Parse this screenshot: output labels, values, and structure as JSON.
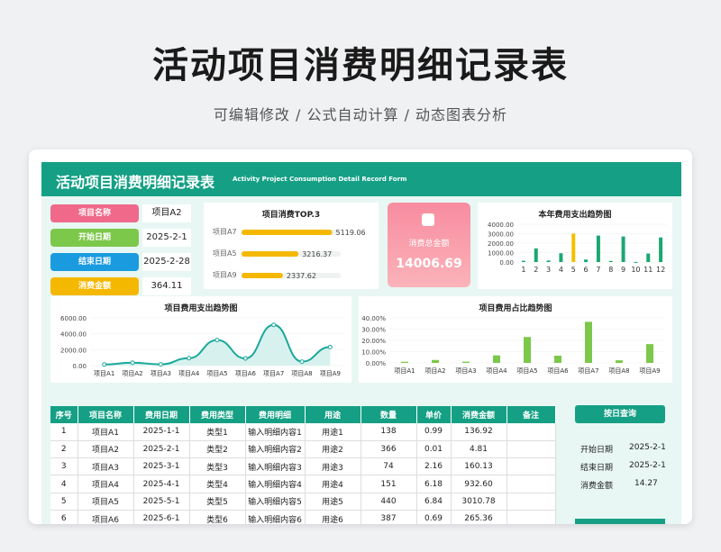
{
  "page": {
    "title": "活动项目消费明细记录表",
    "subtitle": "可编辑修改 /  公式自动计算  /  动态图表分析"
  },
  "banner": {
    "title": "活动项目消费明细记录表",
    "subtitle_en": "Activity Project Consumption Detail Record Form"
  },
  "info": [
    {
      "label": "项目名称",
      "value": "项目A2",
      "color": "#f0698a"
    },
    {
      "label": "开始日期",
      "value": "2025-2-1",
      "color": "#7cc84a"
    },
    {
      "label": "结束日期",
      "value": "2025-2-28",
      "color": "#1a9be0"
    },
    {
      "label": "消费金额",
      "value": "364.11",
      "color": "#f5b800"
    }
  ],
  "total": {
    "label": "消费总金额",
    "value": "14006.69"
  },
  "top3": {
    "title": "项目消费TOP.3",
    "items": [
      {
        "name": "项目A7",
        "value": "5119.06",
        "num": 5119.06
      },
      {
        "name": "项目A5",
        "value": "3216.37",
        "num": 3216.37
      },
      {
        "name": "项目A9",
        "value": "2337.62",
        "num": 2337.62
      }
    ],
    "bar_color": "#f5b800"
  },
  "chart_data": [
    {
      "type": "bar",
      "title": "本年费用支出趋势图",
      "categories": [
        "1",
        "2",
        "3",
        "4",
        "5",
        "6",
        "7",
        "8",
        "9",
        "10",
        "11",
        "12"
      ],
      "values": [
        136.92,
        1440,
        160.13,
        932.6,
        3010.78,
        265.36,
        2800,
        120,
        2700,
        14.27,
        900,
        2600
      ],
      "highlight_index": 4,
      "yticks": [
        "4000.00",
        "3000.00",
        "2000.00",
        "1000.00",
        "0.00"
      ],
      "ylim": [
        0,
        4000
      ],
      "colors": {
        "bar": "#1ba772",
        "highlight": "#f5c000"
      }
    },
    {
      "type": "area",
      "title": "项目费用支出趋势图",
      "categories": [
        "项目A1",
        "项目A2",
        "项目A3",
        "项目A4",
        "项目A5",
        "项目A6",
        "项目A7",
        "项目A8",
        "项目A9"
      ],
      "values": [
        136.92,
        364.11,
        160.13,
        932.6,
        3216.37,
        900,
        5119.06,
        500,
        2337.62
      ],
      "yticks": [
        "6000.00",
        "4000.00",
        "2000.00",
        "0.00"
      ],
      "ylim": [
        0,
        6000
      ],
      "colors": {
        "line": "#1aa89a",
        "fill": "#d7f2ee"
      }
    },
    {
      "type": "bar",
      "title": "项目费用占比趋势图",
      "categories": [
        "项目A1",
        "项目A2",
        "项目A3",
        "项目A4",
        "项目A5",
        "项目A6",
        "项目A7",
        "项目A8",
        "项目A9"
      ],
      "values": [
        1.0,
        2.6,
        1.1,
        6.7,
        23.0,
        6.4,
        36.5,
        2.3,
        16.7
      ],
      "yticks": [
        "40.00%",
        "30.00%",
        "20.00%",
        "10.00%",
        "0.00%"
      ],
      "ylim": [
        0,
        40
      ],
      "colors": {
        "bar": "#7cc84a"
      }
    }
  ],
  "table": {
    "headers": [
      "序号",
      "项目名称",
      "费用日期",
      "费用类型",
      "费用明细",
      "用途",
      "数量",
      "单价",
      "消费金额",
      "备注"
    ],
    "rows": [
      [
        "1",
        "项目A1",
        "2025-1-1",
        "类型1",
        "输入明细内容1",
        "用途1",
        "138",
        "0.99",
        "136.92",
        ""
      ],
      [
        "2",
        "项目A2",
        "2025-2-1",
        "类型2",
        "输入明细内容2",
        "用途2",
        "366",
        "0.01",
        "4.81",
        ""
      ],
      [
        "3",
        "项目A3",
        "2025-3-1",
        "类型3",
        "输入明细内容3",
        "用途3",
        "74",
        "2.16",
        "160.13",
        ""
      ],
      [
        "4",
        "项目A4",
        "2025-4-1",
        "类型4",
        "输入明细内容4",
        "用途4",
        "151",
        "6.18",
        "932.60",
        ""
      ],
      [
        "5",
        "项目A5",
        "2025-5-1",
        "类型5",
        "输入明细内容5",
        "用途5",
        "440",
        "6.84",
        "3010.78",
        ""
      ],
      [
        "6",
        "项目A6",
        "2025-6-1",
        "类型6",
        "输入明细内容6",
        "用途6",
        "387",
        "0.69",
        "265.36",
        ""
      ]
    ]
  },
  "query": {
    "title": "按日查询",
    "rows": [
      {
        "label": "开始日期",
        "value": "2025-2-1"
      },
      {
        "label": "结束日期",
        "value": "2025-2-1"
      },
      {
        "label": "消费金额",
        "value": "14.27"
      }
    ]
  }
}
